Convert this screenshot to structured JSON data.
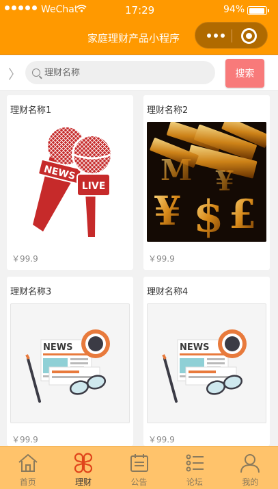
{
  "status": {
    "carrier": "WeChat",
    "time": "17:29",
    "battery": "94%",
    "battery_level": 0.94
  },
  "header": {
    "title": "家庭理财产品小程序"
  },
  "search": {
    "placeholder": "理财名称",
    "button_label": "搜索"
  },
  "products": [
    {
      "name": "理财名称1",
      "price": "￥99.9",
      "image": "news-microphones"
    },
    {
      "name": "理财名称2",
      "price": "￥99.9",
      "image": "gold-currency-symbols"
    },
    {
      "name": "理财名称3",
      "price": "￥99.9",
      "image": "newspaper-coffee-glasses"
    },
    {
      "name": "理财名称4",
      "price": "￥99.9",
      "image": "newspaper-coffee-glasses"
    }
  ],
  "image_text": {
    "news": "NEWS",
    "live": "LIVE"
  },
  "tabs": [
    {
      "label": "首页",
      "icon": "home-icon",
      "active": false
    },
    {
      "label": "理财",
      "icon": "clover-icon",
      "active": true
    },
    {
      "label": "公告",
      "icon": "calendar-icon",
      "active": false
    },
    {
      "label": "论坛",
      "icon": "list-icon",
      "active": false
    },
    {
      "label": "我的",
      "icon": "user-icon",
      "active": false
    }
  ],
  "colors": {
    "accent": "#ff9900",
    "search_button": "#f87a7a",
    "tabbar": "#ffc36b",
    "active_icon": "#e0451b"
  }
}
